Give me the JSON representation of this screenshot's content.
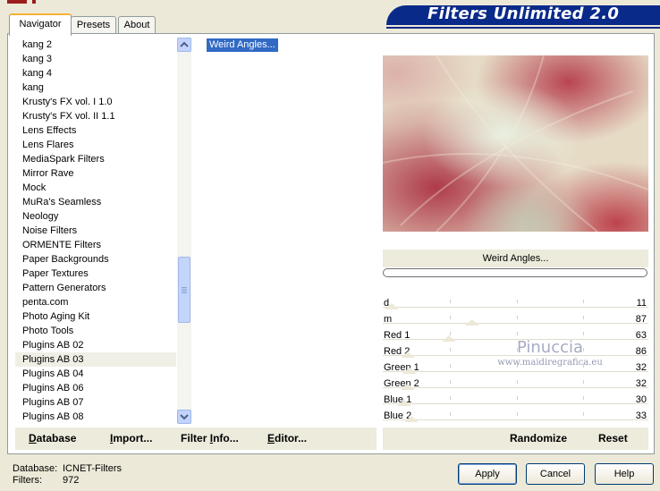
{
  "window": {
    "title": "Filters Unlimited 2.0"
  },
  "tabs": [
    {
      "label": "Navigator"
    },
    {
      "label": "Presets"
    },
    {
      "label": "About"
    }
  ],
  "categories": [
    "kang 2",
    "kang 3",
    "kang 4",
    "kang",
    "Krusty's FX vol. I 1.0",
    "Krusty's FX vol. II 1.1",
    "Lens Effects",
    "Lens Flares",
    "MediaSpark Filters",
    "Mirror Rave",
    "Mock",
    "MuRa's Seamless",
    "Neology",
    "Noise Filters",
    "ORMENTE Filters",
    "Paper Backgrounds",
    "Paper Textures",
    "Pattern Generators",
    "penta.com",
    "Photo Aging Kit",
    "Photo Tools",
    "Plugins AB 02",
    "Plugins AB 03",
    "Plugins AB 04",
    "Plugins AB 06",
    "Plugins AB 07",
    "Plugins AB 08"
  ],
  "selected_category": "Plugins AB 03",
  "filters": [
    "Weird Angles..."
  ],
  "preview": {
    "filter_name": "Weird Angles...",
    "progress": 0
  },
  "parameters": [
    {
      "label": "d",
      "value": "11"
    },
    {
      "label": "m",
      "value": "87"
    },
    {
      "label": "Red 1",
      "value": "63"
    },
    {
      "label": "Red 2",
      "value": "86"
    },
    {
      "label": "Green 1",
      "value": "32"
    },
    {
      "label": "Green 2",
      "value": "32"
    },
    {
      "label": "Blue 1",
      "value": "30"
    },
    {
      "label": "Blue 2",
      "value": "33"
    }
  ],
  "watermark": {
    "name": "Pinuccia",
    "site": "www.maidiregrafica.eu"
  },
  "left_buttons": {
    "database": "Database",
    "import": "Import...",
    "filter_info": "Filter Info...",
    "editor": "Editor..."
  },
  "right_buttons": {
    "randomize": "Randomize",
    "reset": "Reset"
  },
  "status": {
    "database_label": "Database:",
    "database_value": "ICNET-Filters",
    "filters_label": "Filters:",
    "filters_value": "972"
  },
  "dialog_buttons": {
    "apply": "Apply",
    "cancel": "Cancel",
    "help": "Help"
  },
  "colors": {
    "banner": "#0a2a8a",
    "selection": "#316ac5",
    "window_bg": "#ece9d8"
  }
}
